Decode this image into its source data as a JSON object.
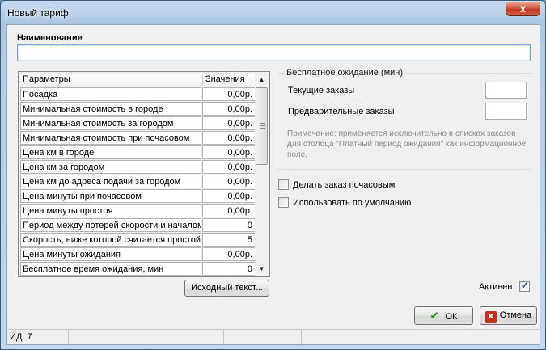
{
  "window": {
    "title": "Новый тариф",
    "close_label": "x"
  },
  "name_section": {
    "label": "Наименование",
    "value": ""
  },
  "params_grid": {
    "columns": [
      "Параметры",
      "Значения"
    ],
    "rows": [
      {
        "param": "Посадка",
        "value": "0,00р."
      },
      {
        "param": "Минимальная стоимость в городе",
        "value": "0,00р."
      },
      {
        "param": "Минимальная стоимость за городом",
        "value": "0,00р."
      },
      {
        "param": "Минимальная стоимость при почасовом",
        "value": "0,00р."
      },
      {
        "param": "Цена км в городе",
        "value": "0,00р."
      },
      {
        "param": "Цена км за городом",
        "value": "0,00р."
      },
      {
        "param": "Цена км до адреса подачи за городом",
        "value": "0,00р."
      },
      {
        "param": "Цена минуты при почасовом",
        "value": "0,00р."
      },
      {
        "param": "Цена минуты простоя",
        "value": "0,00р."
      },
      {
        "param": "Период между потерей скорости и началом",
        "value": "0"
      },
      {
        "param": "Скорость, ниже которой считается простой",
        "value": "5"
      },
      {
        "param": "Цена минуты ожидания",
        "value": "0,00р."
      },
      {
        "param": "Бесплатное время ожидания, мин",
        "value": "0"
      }
    ]
  },
  "source_button": "Исходный текст...",
  "free_wait": {
    "legend": "Бесплатное ожидание (мин)",
    "current_label": "Текущие заказы",
    "current_value": "",
    "prelim_label": "Предварительные заказы",
    "prelim_value": "",
    "note": "Примечание: применяется исключительно в списках заказов для столбца \"Платный период ожидания\" как информационное поле."
  },
  "options": {
    "hourly_label": "Делать заказ почасовым",
    "hourly_checked": false,
    "default_label": "Использовать по умолчанию",
    "default_checked": false
  },
  "active": {
    "label": "Активен",
    "checked": true
  },
  "buttons": {
    "ok": "ОК",
    "cancel": "Отмена"
  },
  "statusbar": {
    "id_text": "ИД: 7"
  }
}
